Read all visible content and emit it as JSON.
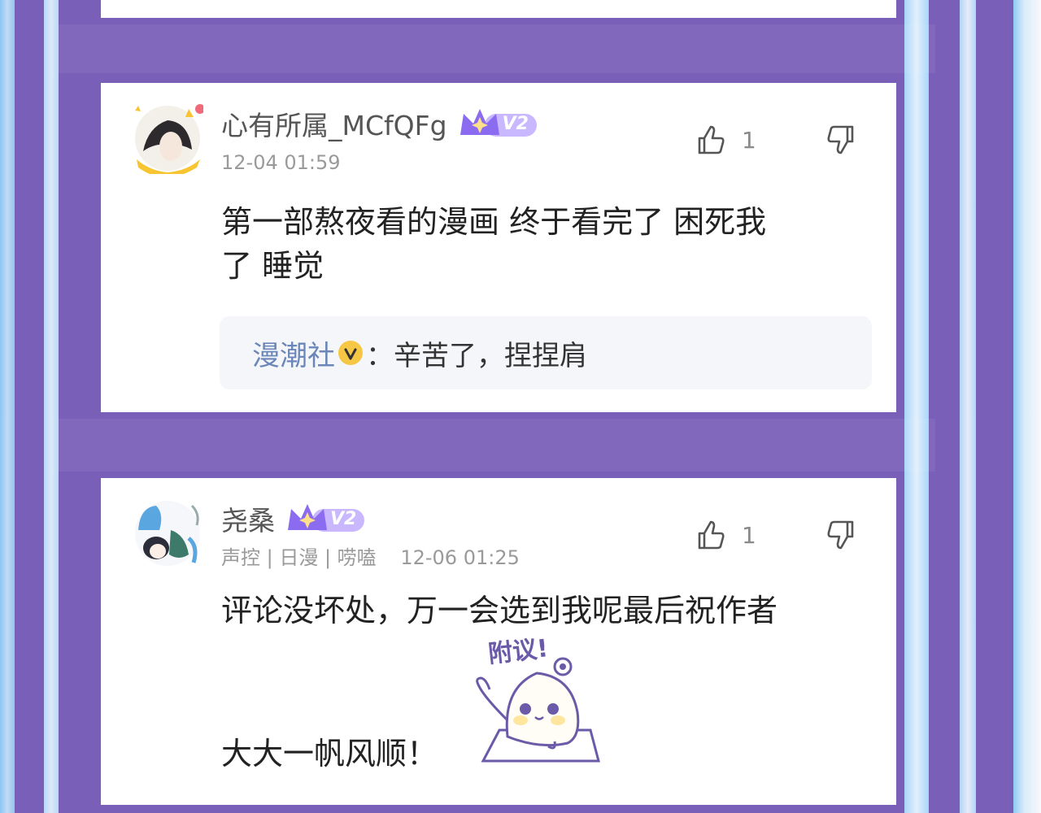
{
  "comments": [
    {
      "username": "心有所属_MCfQFg",
      "level": "V2",
      "timestamp": "12-04 01:59",
      "likes": "1",
      "content_line1": "第一部熬夜看的漫画 终于看完了 困死我",
      "content_line2": "了 睡觉",
      "reply": {
        "author": "漫潮社",
        "separator": "：",
        "text": "辛苦了，捏捏肩"
      }
    },
    {
      "username": "尧桑",
      "level": "V2",
      "tags": "声控 | 日漫 | 唠嗑",
      "timestamp": "12-06 01:25",
      "likes": "1",
      "content_line1": "评论没坏处，万一会选到我呢最后祝作者",
      "content_line2": "大大一帆风顺！",
      "sticker_text": "附议!"
    }
  ],
  "colors": {
    "background": "#7a5fb8",
    "accent_purple": "#8b6cf0",
    "reply_author": "#6b86b8"
  }
}
